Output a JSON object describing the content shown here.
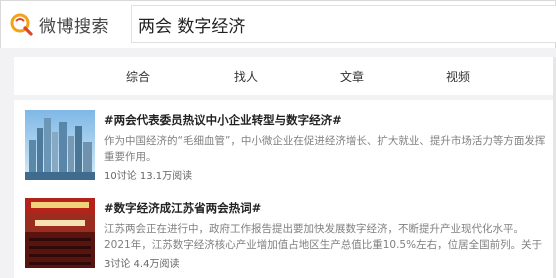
{
  "header": {
    "logo_text": "微博搜索",
    "search_value": "两会 数字经济"
  },
  "tabs": [
    {
      "label": "综合"
    },
    {
      "label": "找人"
    },
    {
      "label": "文章"
    },
    {
      "label": "视频"
    }
  ],
  "results": [
    {
      "title": "#两会代表委员热议中小企业转型与数字经济#",
      "desc": "作为中国经济的“毛细血管”，中小微企业在促进经济增长、扩大就业、提升市场活力等方面发挥重要作用。",
      "meta": "10讨论 13.1万阅读",
      "thumb_icon": "city-skyline-image"
    },
    {
      "title": "#数字经济成江苏省两会热词#",
      "desc": "江苏两会正在进行中，政府工作报告提出要加快发展数字经济，不断提升产业现代化水平。2021年，江苏数字经济核心产业增加值占地区生产总值比重10.5%左右，位居全国前列。关于如何继续做...",
      "meta": "3讨论 4.4万阅读",
      "thumb_icon": "conference-hall-image"
    }
  ],
  "colors": {
    "brand_orange": "#f2a31b",
    "brand_red": "#e0452c",
    "page_bg": "#f2f2f5"
  }
}
